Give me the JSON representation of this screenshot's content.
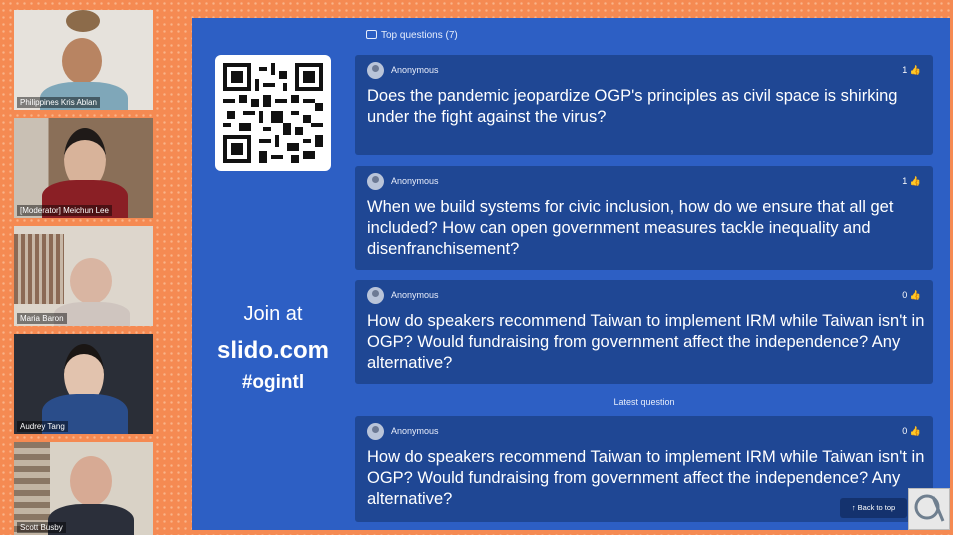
{
  "participants": [
    {
      "name": "Philippines Kris Ablan"
    },
    {
      "name": "[Moderator] Meichun Lee"
    },
    {
      "name": "Maria Baron"
    },
    {
      "name": "Audrey Tang"
    },
    {
      "name": "Scott Busby"
    }
  ],
  "slido": {
    "join_at": "Join at",
    "url": "slido.com",
    "hashtag": "#ogintl",
    "top_questions_label": "Top questions (7)",
    "latest_label": "Latest question",
    "back_to_top": "Back to top",
    "questions": [
      {
        "author": "Anonymous",
        "likes": "1",
        "text": "Does the pandemic jeopardize OGP's principles as civil space is shirking under the fight against the virus?"
      },
      {
        "author": "Anonymous",
        "likes": "1",
        "text": "When we build systems for civic inclusion, how do we ensure that all get included? How can open government measures tackle inequality and disenfranchisement?"
      },
      {
        "author": "Anonymous",
        "likes": "0",
        "text": "How do speakers recommend Taiwan to implement IRM while Taiwan isn't in OGP? Would fundraising from government affect the independence? Any alternative?"
      }
    ],
    "latest_question": {
      "author": "Anonymous",
      "likes": "0",
      "text": "How do speakers recommend Taiwan to implement IRM while Taiwan isn't in OGP? Would fundraising from government affect the independence? Any alternative?"
    }
  },
  "colors": {
    "panel": "#2d5fc4",
    "card": "#1f4794",
    "background": "#f58a52"
  }
}
